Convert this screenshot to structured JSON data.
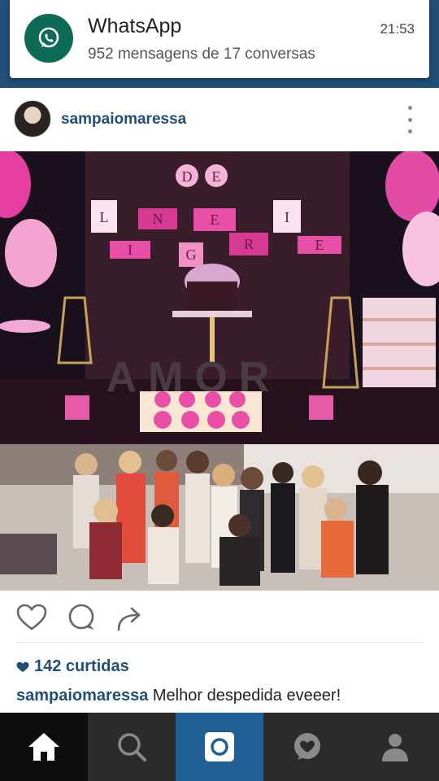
{
  "notification": {
    "app": "WhatsApp",
    "message": "952 mensagens de 17 conversas",
    "time": "21:53",
    "icon": "whatsapp-icon"
  },
  "post": {
    "username": "sampaiomaressa",
    "likes": "142 curtidas",
    "caption_user": "sampaiomaressa",
    "caption_text": "Melhor despedida eveeer!",
    "photo_letters_top": [
      "D",
      "E"
    ],
    "photo_letters_row": [
      "L",
      "I",
      "N",
      "G",
      "E",
      "R",
      "I",
      "E"
    ],
    "photo_word": "AMOR"
  },
  "actions": [
    "like-icon",
    "comment-icon",
    "share-icon"
  ],
  "nav": [
    "home-icon",
    "search-icon",
    "camera-icon",
    "activity-icon",
    "profile-icon"
  ],
  "colors": {
    "brand": "#1f4f76",
    "accent": "#1f5f94",
    "whatsapp": "#0d6b55"
  }
}
